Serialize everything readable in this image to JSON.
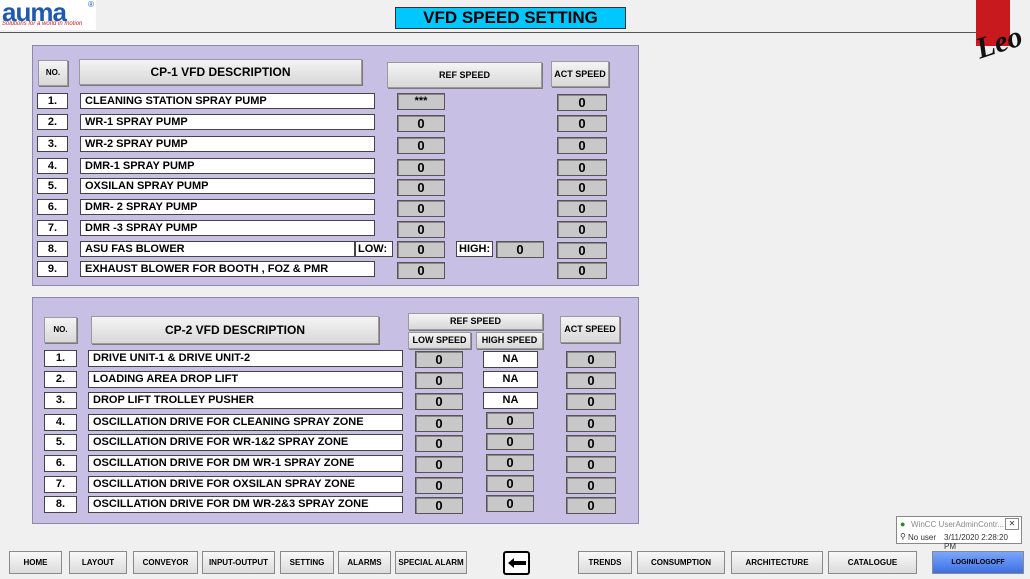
{
  "header": {
    "logo": "auma",
    "logo_mark": "®",
    "logo_tagline": "Solutions for a world in motion",
    "title": "VFD SPEED SETTING",
    "right_logo": "Leo"
  },
  "cp1": {
    "header_no": "NO.",
    "header_desc": "CP-1 VFD DESCRIPTION",
    "header_ref": "REF SPEED",
    "header_act": "ACT SPEED",
    "low_label": "LOW:",
    "high_label": "HIGH:",
    "rows": [
      {
        "no": "1.",
        "desc": "CLEANING STATION SPRAY PUMP",
        "ref": "***",
        "act": "0"
      },
      {
        "no": "2.",
        "desc": "WR-1 SPRAY PUMP",
        "ref": "0",
        "act": "0"
      },
      {
        "no": "3.",
        "desc": "WR-2 SPRAY PUMP",
        "ref": "0",
        "act": "0"
      },
      {
        "no": "4.",
        "desc": "DMR-1 SPRAY PUMP",
        "ref": "0",
        "act": "0"
      },
      {
        "no": "5.",
        "desc": "OXSILAN SPRAY PUMP",
        "ref": "0",
        "act": "0"
      },
      {
        "no": "6.",
        "desc": "DMR- 2 SPRAY PUMP",
        "ref": "0",
        "act": "0"
      },
      {
        "no": "7.",
        "desc": "DMR -3 SPRAY PUMP",
        "ref": "0",
        "act": "0"
      },
      {
        "no": "8.",
        "desc": "ASU FAS BLOWER",
        "ref": "0",
        "high": "0",
        "act": "0"
      },
      {
        "no": "9.",
        "desc": "EXHAUST BLOWER FOR BOOTH , FOZ & PMR",
        "ref": "0",
        "act": "0"
      }
    ]
  },
  "cp2": {
    "header_no": "NO.",
    "header_desc": "CP-2 VFD DESCRIPTION",
    "header_ref": "REF SPEED",
    "header_low": "LOW SPEED",
    "header_high": "HIGH SPEED",
    "header_act": "ACT SPEED",
    "rows": [
      {
        "no": "1.",
        "desc": "DRIVE UNIT-1 & DRIVE UNIT-2",
        "low": "0",
        "high": "NA",
        "act": "0"
      },
      {
        "no": "2.",
        "desc": "LOADING AREA DROP LIFT",
        "low": "0",
        "high": "NA",
        "act": "0"
      },
      {
        "no": "3.",
        "desc": "DROP LIFT TROLLEY PUSHER",
        "low": "0",
        "high": "NA",
        "act": "0"
      },
      {
        "no": "4.",
        "desc": "OSCILLATION DRIVE FOR CLEANING SPRAY ZONE",
        "low": "0",
        "high": "0",
        "act": "0"
      },
      {
        "no": "5.",
        "desc": "OSCILLATION DRIVE FOR WR-1&2 SPRAY ZONE",
        "low": "0",
        "high": "0",
        "act": "0"
      },
      {
        "no": "6.",
        "desc": "OSCILLATION DRIVE FOR DM WR-1 SPRAY ZONE",
        "low": "0",
        "high": "0",
        "act": "0"
      },
      {
        "no": "7.",
        "desc": "OSCILLATION DRIVE FOR OXSILAN SPRAY ZONE",
        "low": "0",
        "high": "0",
        "act": "0"
      },
      {
        "no": "8.",
        "desc": "OSCILLATION DRIVE FOR DM WR-2&3 SPRAY ZONE",
        "low": "0",
        "high": "0",
        "act": "0"
      }
    ]
  },
  "status": {
    "app": "WinCC UserAdminContr...",
    "user": "No user",
    "datetime": "3/11/2020  2:28:20 PM"
  },
  "nav": {
    "home": "HOME",
    "layout": "LAYOUT",
    "conveyor": "CONVEYOR",
    "input_output": "INPUT-OUTPUT",
    "setting": "SETTING",
    "alarms": "ALARMS",
    "special_alarm": "SPECIAL ALARM",
    "trends": "TRENDS",
    "consumption": "CONSUMPTION",
    "architecture": "ARCHITECTURE",
    "catalogue": "CATALOGUE",
    "login": "LOGIN/LOGOFF"
  },
  "colors": {
    "title_bg": "#00c8ff",
    "panel_bg": "#c8c0e4",
    "login_bg": "#3d6fe0",
    "logo_blue": "#1e5bb0",
    "logo_red": "#c8191e"
  }
}
